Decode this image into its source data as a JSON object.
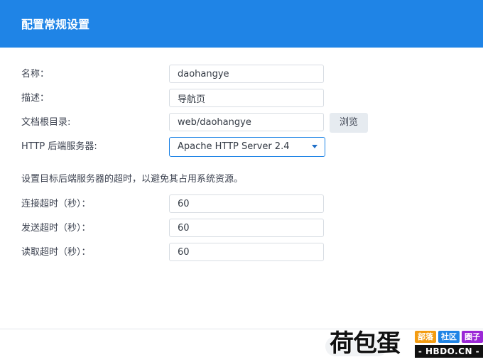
{
  "dialog": {
    "title": "配置常规设置"
  },
  "form": {
    "name": {
      "label": "名称：",
      "value": "daohangye"
    },
    "description": {
      "label": "描述：",
      "value": "导航页"
    },
    "docroot": {
      "label": "文档根目录:",
      "value": "web/daohangye",
      "browse_label": "浏览"
    },
    "http_backend": {
      "label": "HTTP 后端服务器:",
      "selected": "Apache HTTP Server 2.4"
    },
    "timeout_hint": "设置目标后端服务器的超时，以避免其占用系统资源。",
    "connect_timeout": {
      "label": "连接超时（秒）：",
      "value": "60"
    },
    "send_timeout": {
      "label": "发送超时（秒）：",
      "value": "60"
    },
    "read_timeout": {
      "label": "读取超时（秒）：",
      "value": "60"
    }
  },
  "watermark": {
    "text": "荷包蛋",
    "tags": [
      "部落",
      "社区",
      "圈子"
    ],
    "domain": "- HBDO.CN -",
    "tag_colors": [
      "#f39c12",
      "#1f84e6",
      "#9b27d6"
    ]
  },
  "colors": {
    "accent": "#1f84e6"
  }
}
